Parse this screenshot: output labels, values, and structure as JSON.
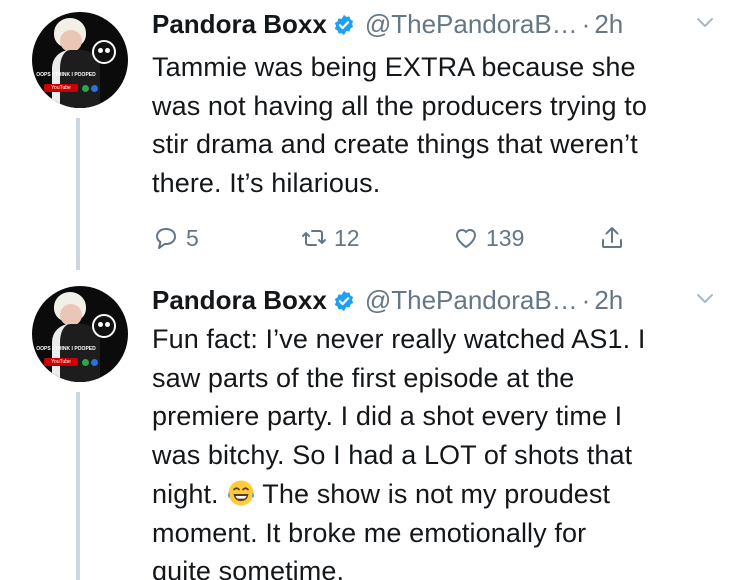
{
  "colors": {
    "text": "#14171a",
    "secondary": "#657786",
    "verified": "#1da1f2",
    "thread_line": "#ccd6dd"
  },
  "avatar_caption": "OOPS I THINK I POOPED",
  "avatar_badge": "YouTube",
  "tweets": [
    {
      "name": "Pandora Boxx",
      "handle": "@ThePandoraB…",
      "separator": "·",
      "time": "2h",
      "text_lines": [
        "Tammie was being EXTRA because she",
        "was not having all the producers trying to",
        "stir drama and create things that weren’t",
        "there. It’s hilarious."
      ],
      "replies": "5",
      "retweets": "12",
      "likes": "139"
    },
    {
      "name": "Pandora Boxx",
      "handle": "@ThePandoraB…",
      "separator": "·",
      "time": "2h",
      "text_lines": [
        "Fun fact: I’ve never really watched AS1. I",
        "saw parts of the first episode at the",
        "premiere party. I did a shot every time I",
        "was bitchy. So I had a LOT of shots that",
        "night.",
        "The show is not my proudest",
        "moment. It broke me emotionally for",
        "quite sometime."
      ]
    }
  ]
}
